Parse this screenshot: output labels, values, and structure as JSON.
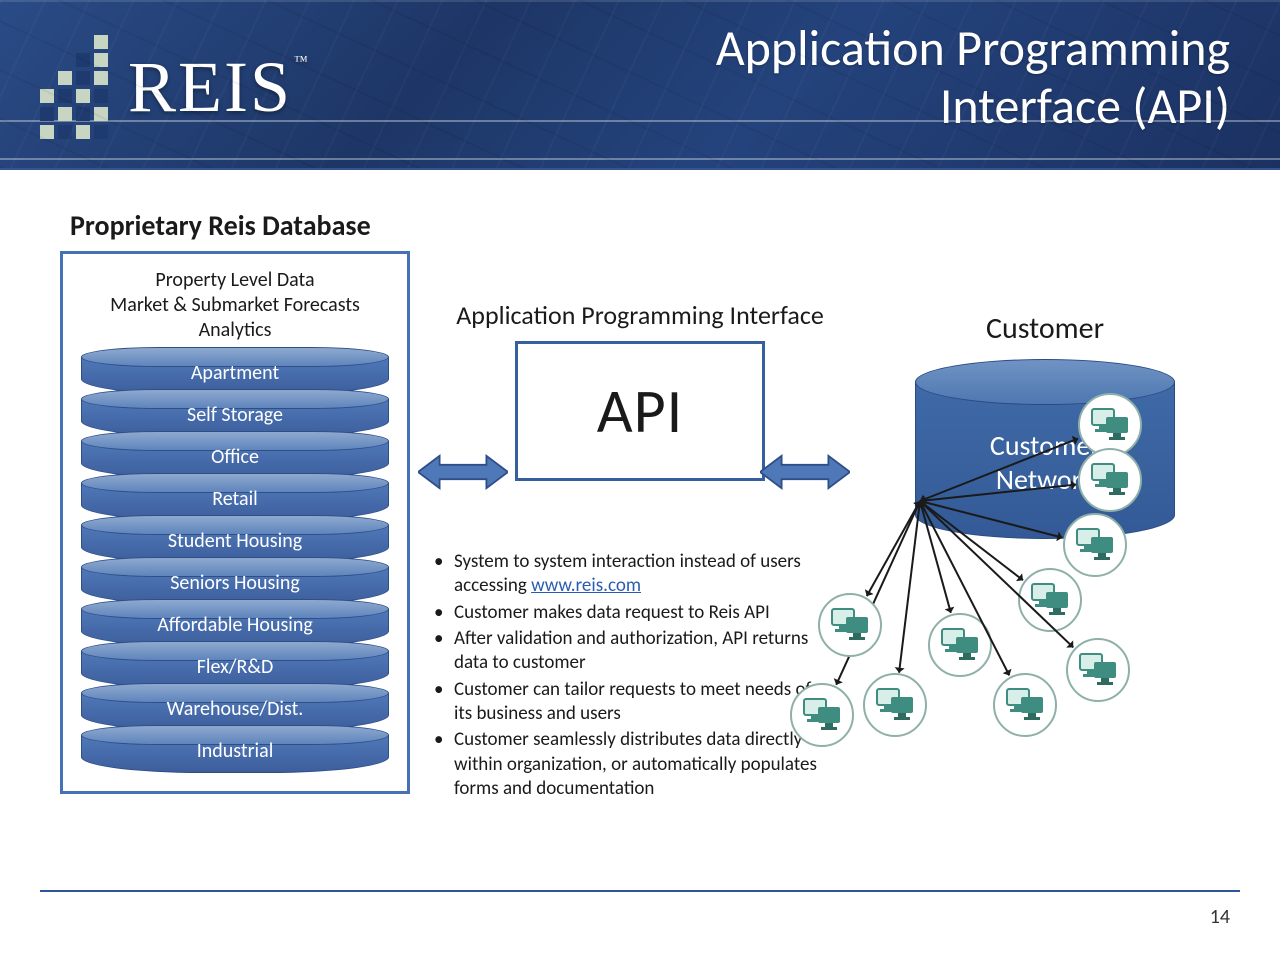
{
  "logo_text": "REIS",
  "title_line1": "Application Programming",
  "title_line2": "Interface (API)",
  "db": {
    "heading": "Proprietary Reis Database",
    "meta1": "Property Level Data",
    "meta2": "Market & Submarket Forecasts",
    "meta3": "Analytics",
    "items": [
      "Apartment",
      "Self Storage",
      "Office",
      "Retail",
      "Student Housing",
      "Seniors Housing",
      "Affordable Housing",
      "Flex/R&D",
      "Warehouse/Dist.",
      "Industrial"
    ]
  },
  "mid_heading": "Application Programming Interface",
  "api_label": "API",
  "customer_heading": "Customer",
  "cylinder_line1": "Customer",
  "cylinder_line2": "Network",
  "link_text": "www.reis.com",
  "bullets": [
    "System to system interaction instead of users accessing ",
    "Customer makes data request to Reis API",
    "After validation and authorization, API returns data to customer",
    "Customer can tailor requests to meet needs of its business and users",
    "Customer seamlessly distributes data directly within organization, or automatically populates forms and documentation"
  ],
  "page_number": "14"
}
